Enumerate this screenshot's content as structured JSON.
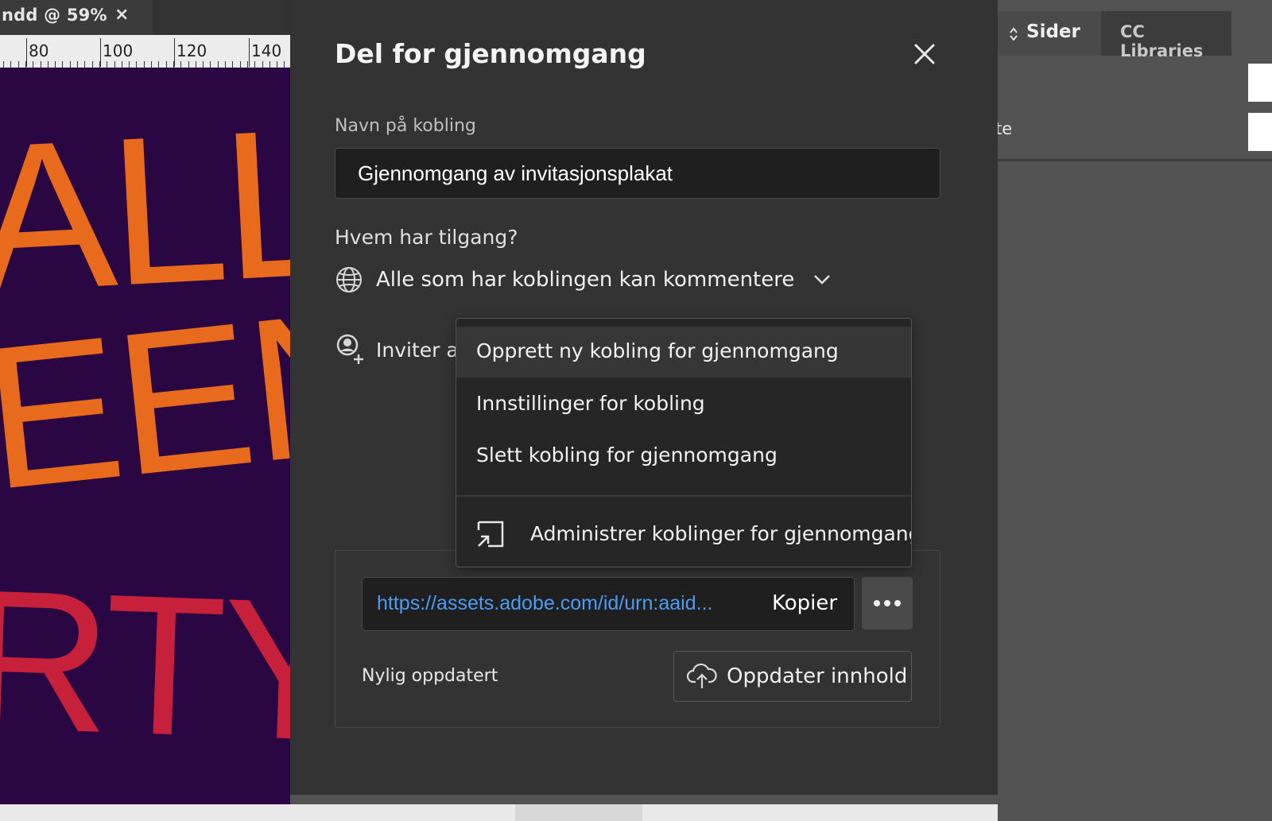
{
  "document_tab": {
    "title": "ndd @ 59%",
    "close_glyph": "×"
  },
  "ruler": {
    "labels": [
      "80",
      "100",
      "120",
      "140"
    ]
  },
  "canvas": {
    "background": "#2a0642",
    "words": [
      {
        "text": "ALLO",
        "color": "#e86a1c"
      },
      {
        "text": "EEN",
        "color": "#e86a1c"
      },
      {
        "text": "RTY",
        "color": "#c6203a"
      }
    ]
  },
  "right_panel": {
    "tabs": [
      {
        "label": "Sider",
        "icon": "updown-arrows-icon"
      },
      {
        "label": "CC Libraries"
      }
    ],
    "partial_text": "te"
  },
  "dialog": {
    "title": "Del for gjennomgang",
    "close_icon": "close-icon",
    "name_label": "Navn på kobling",
    "name_value": "Gjennomgang av invitasjonsplakat",
    "access_label": "Hvem har tilgang?",
    "access_value": "Alle som har koblingen kan kommentere",
    "invite_text": "Inviter andre",
    "link_url": "https://assets.adobe.com/id/urn:aaid...",
    "copy_label": "Kopier",
    "more_label": "•••",
    "recent_label": "Nylig oppdatert",
    "update_label": "Oppdater innhold",
    "accent_color": "#4b9cf5"
  },
  "menu": {
    "items": [
      {
        "label": "Opprett ny kobling for gjennomgang",
        "highlighted": true
      },
      {
        "label": "Innstillinger for kobling"
      },
      {
        "label": "Slett kobling for gjennomgang"
      }
    ],
    "manage_item": {
      "label": "Administrer koblinger for gjennomgang",
      "icon": "manage-links-icon"
    }
  }
}
